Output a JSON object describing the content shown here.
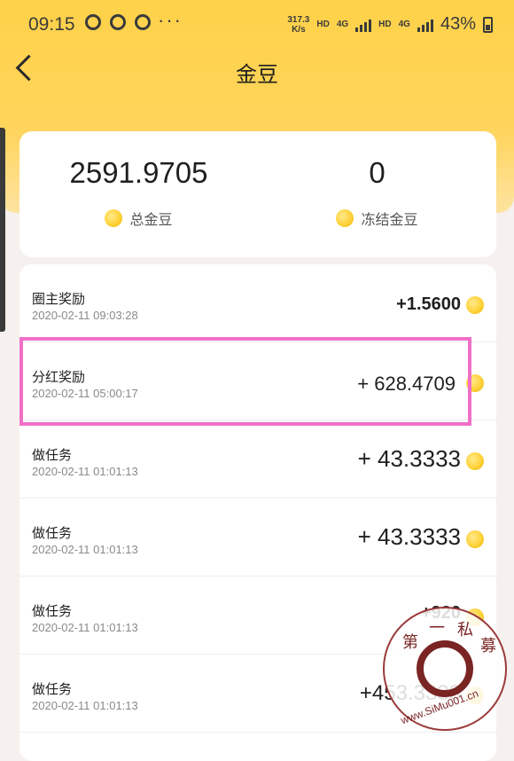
{
  "status_bar": {
    "time": "09:15",
    "dots": "···",
    "speed_value": "317.3",
    "speed_unit": "K/s",
    "hd1": "HD",
    "net1": "4G",
    "hd2": "HD",
    "net2": "4G",
    "battery": "43%"
  },
  "nav": {
    "title": "金豆"
  },
  "summary": {
    "total_value": "2591.9705",
    "total_label": "总金豆",
    "frozen_value": "0",
    "frozen_label": "冻结金豆"
  },
  "records": [
    {
      "title": "圈主奖励",
      "date": "2020-02-11 09:03:28",
      "amount": "+1.5600"
    },
    {
      "title": "分红奖励",
      "date": "2020-02-11 05:00:17",
      "amount": "+ 628.4709"
    },
    {
      "title": "做任务",
      "date": "2020-02-11 01:01:13",
      "amount": "+ 43.3333"
    },
    {
      "title": "做任务",
      "date": "2020-02-11 01:01:13",
      "amount": "+ 43.3333"
    },
    {
      "title": "做任务",
      "date": "2020-02-11 01:01:13",
      "amount": "+920"
    },
    {
      "title": "做任务",
      "date": "2020-02-11 01:01:13",
      "amount": "+453.3333"
    }
  ],
  "watermark": {
    "chars": [
      "第",
      "一",
      "私",
      "募"
    ],
    "url": "www.SiMu001.cn"
  },
  "colors": {
    "header_yellow": "#ffd24a",
    "highlight_pink": "#f070c8",
    "bean_gold": "#ffd23a"
  }
}
